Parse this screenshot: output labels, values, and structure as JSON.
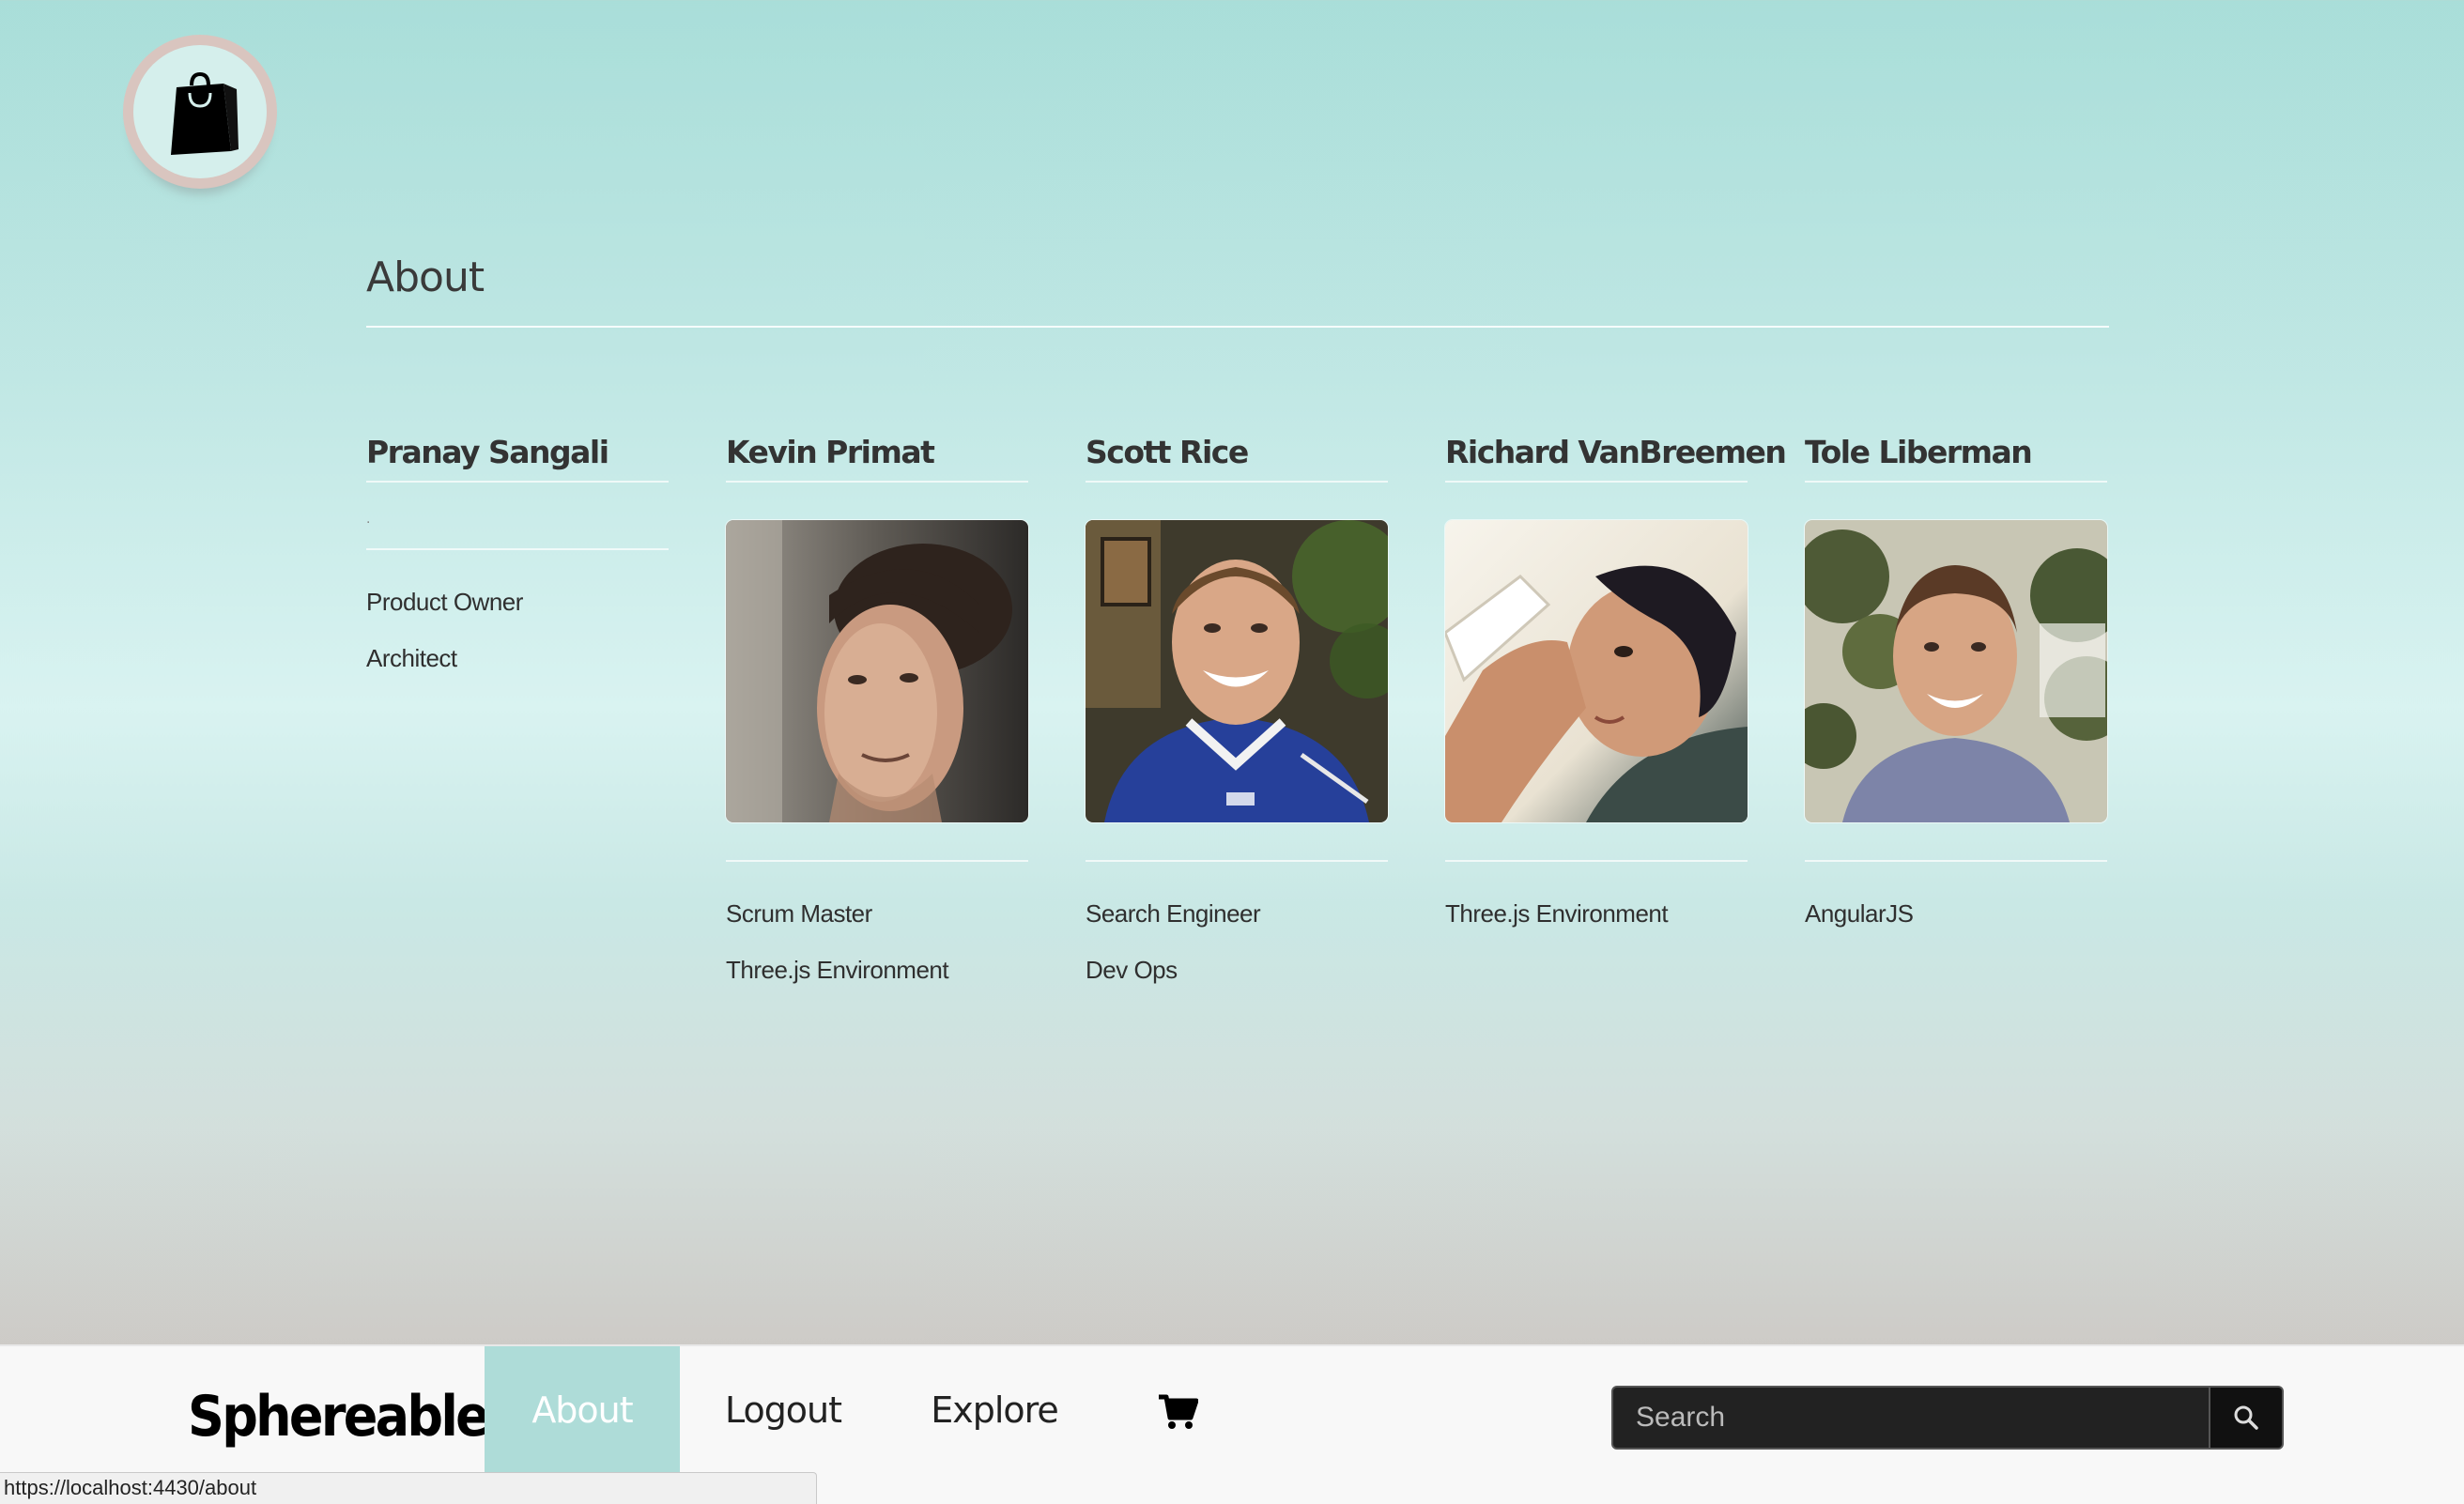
{
  "header": {
    "logo_icon": "shopping-bag-icon"
  },
  "page": {
    "title": "About"
  },
  "team": [
    {
      "name": "Pranay Sangali",
      "placeholder": ".",
      "roles": [
        "Product Owner",
        "Architect"
      ]
    },
    {
      "name": "Kevin Primat",
      "roles": [
        "Scrum Master",
        "Three.js Environment"
      ]
    },
    {
      "name": "Scott Rice",
      "roles": [
        "Search Engineer",
        "Dev Ops"
      ]
    },
    {
      "name": "Richard VanBreemen",
      "roles": [
        "Three.js Environment"
      ]
    },
    {
      "name": "Tole Liberman",
      "roles": [
        "AngularJS"
      ]
    }
  ],
  "navbar": {
    "brand": "Sphereable",
    "items": [
      {
        "label": "About",
        "active": true
      },
      {
        "label": "Logout"
      },
      {
        "label": "Explore"
      }
    ],
    "cart_icon": "shopping-cart-icon",
    "search": {
      "placeholder": "Search",
      "button_icon": "search-icon"
    }
  },
  "status_bar": {
    "url": "https://localhost:4430/about"
  },
  "colors": {
    "accent": "#aedcd8",
    "nav_bg": "#f8f8f8",
    "search_bg": "#222222"
  }
}
